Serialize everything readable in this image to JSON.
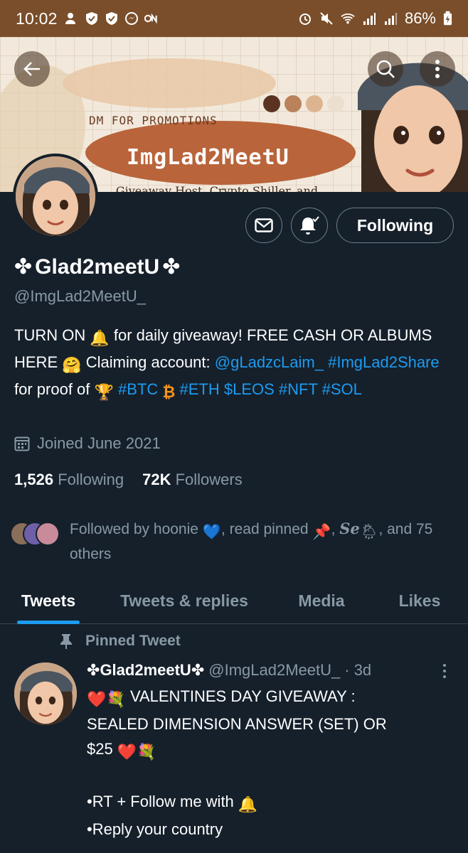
{
  "status_bar": {
    "time": "10:02",
    "battery": "86%"
  },
  "banner": {
    "promo": "DM FOR PROMOTIONS",
    "brand": "ImgLad2MeetU",
    "tagline": "Giveaway Host, Crypto Shiller, and Social Media Promoter"
  },
  "profile": {
    "display_name": "Glad2meetU",
    "handle": "@ImgLad2MeetU_",
    "bio": {
      "part1": "TURN ON",
      "part2": "for daily giveaway! FREE CASH OR ALBUMS HERE",
      "part3": "Claiming account:",
      "mention": "@gLadzcLaim_",
      "hashtag1": "#ImgLad2Share",
      "part4": "for proof of",
      "tag_btc": "#BTC",
      "tag_eth": "#ETH",
      "tags_rest": "$LEOS #NFT #SOL"
    },
    "joined": "Joined June 2021",
    "following_count": "1,526",
    "following_label": "Following",
    "followers_count": "72K",
    "followers_label": "Followers",
    "followed_by": {
      "part1": "Followed by hoonie",
      "part2": ", read pinned",
      "part3": ",",
      "name3": "Se",
      "part4": ", and 75 others"
    }
  },
  "buttons": {
    "following": "Following"
  },
  "tabs": [
    {
      "label": "Tweets"
    },
    {
      "label": "Tweets & replies"
    },
    {
      "label": "Media"
    },
    {
      "label": "Likes"
    }
  ],
  "tweet": {
    "pinned_label": "Pinned Tweet",
    "author_name": "Glad2meetU",
    "author_handle": "@ImgLad2MeetU_",
    "time": "· 3d",
    "line1": "VALENTINES DAY GIVEAWAY :",
    "line2": "SEALED DIMENSION ANSWER (SET) OR",
    "line3": "$25",
    "line4": "•RT + Follow me with",
    "line5": "•Reply your country"
  },
  "colors": {
    "background": "#15202b",
    "accent": "#1d9bf0",
    "muted": "#8899a6",
    "status_bar": "#7a4e2a"
  }
}
